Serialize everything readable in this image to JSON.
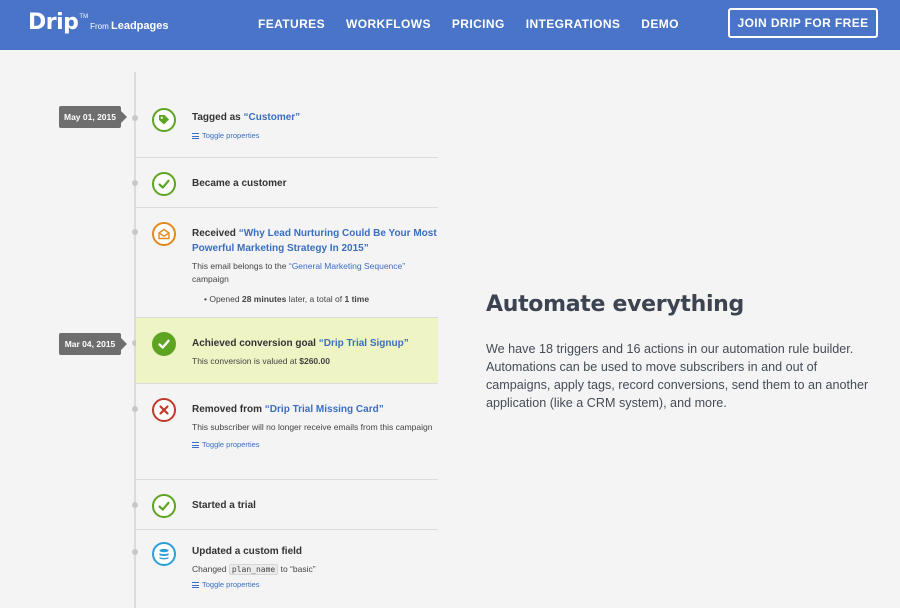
{
  "nav": {
    "logo": "Drip",
    "logo_tm": "TM",
    "logo_from": "From",
    "logo_brand": "Leadpages",
    "links": [
      "FEATURES",
      "WORKFLOWS",
      "PRICING",
      "INTEGRATIONS",
      "DEMO"
    ],
    "cta": "JOIN DRIP FOR FREE"
  },
  "timeline": {
    "dates": [
      "May 01, 2015",
      "Mar 04, 2015"
    ],
    "events": [
      {
        "title_prefix": "Tagged as ",
        "title_link": "“Customer”",
        "toggle": "Toggle properties",
        "icon": "tag-icon"
      },
      {
        "title_prefix": "Became a customer",
        "icon": "check-icon"
      },
      {
        "title_prefix": "Received ",
        "title_link": "“Why Lead Nurturing Could Be Your Most Powerful Marketing Strategy In 2015”",
        "sub_prefix": "This email belongs to the ",
        "sub_link": "“General Marketing Sequence”",
        "sub_suffix": " campaign",
        "bullet_prefix": "Opened ",
        "bullet_strong1": "28 minutes",
        "bullet_mid": " later, a total of ",
        "bullet_strong2": "1 time",
        "icon": "envelope-open-icon"
      },
      {
        "title_prefix": "Achieved conversion goal ",
        "title_link": "“Drip Trial Signup”",
        "sub_prefix": "This conversion is valued at ",
        "sub_strong": "$260.00",
        "icon": "check-filled-icon"
      },
      {
        "title_prefix": "Removed from ",
        "title_link": "“Drip Trial Missing Card”",
        "sub": "This subscriber will no longer receive emails from this campaign",
        "toggle": "Toggle properties",
        "icon": "x-icon"
      },
      {
        "title_prefix": "Started a trial",
        "icon": "check-icon"
      },
      {
        "title_prefix": "Updated a custom field",
        "sub_prefix": "Changed ",
        "sub_code": "plan_name",
        "sub_suffix": " to “basic”",
        "toggle": "Toggle properties",
        "icon": "database-icon"
      }
    ]
  },
  "content": {
    "headline": "Automate everything",
    "description": "We have 18 triggers and 16 actions in our automation rule builder. Automations can be used to move subscribers in and out of campaigns, apply tags, record conversions, send them to an another application (like a CRM system), and more."
  },
  "colors": {
    "nav_bg": "#4a74c7",
    "link": "#3a6ec1",
    "highlight": "#eef4c4",
    "check_green": "#5da423",
    "remove_red": "#c0392b",
    "email_orange": "#e08a1e",
    "field_blue": "#2a9fd8"
  }
}
